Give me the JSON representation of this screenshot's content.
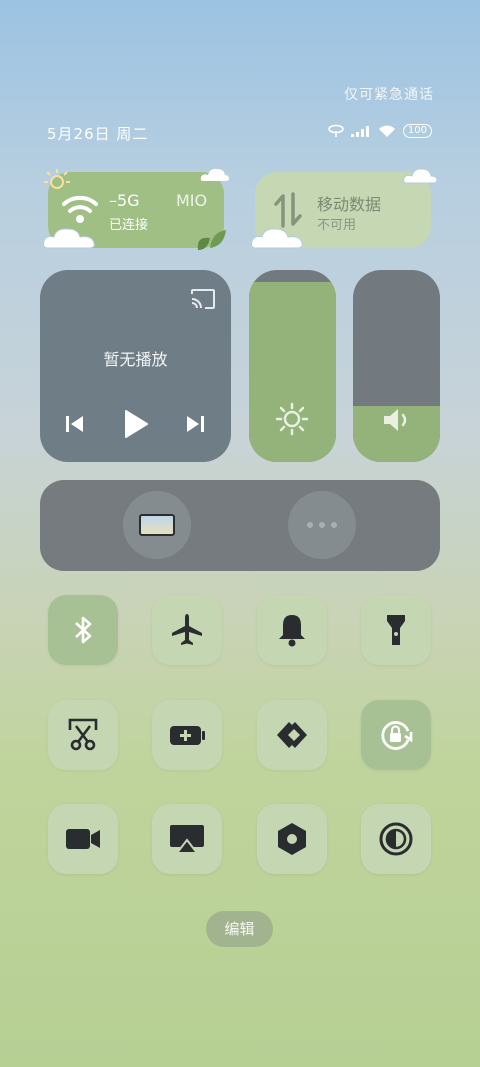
{
  "status": {
    "top_text": "仅可紧急通话",
    "date": "5月26日 周二",
    "battery": "100"
  },
  "wifi_tile": {
    "title": "–5G",
    "title_suffix": "MIO",
    "subtitle": "已连接"
  },
  "mobile_tile": {
    "title": "移动数据",
    "subtitle": "不可用"
  },
  "media": {
    "label": "暂无播放"
  },
  "sliders": {
    "brightness_level": 0.94,
    "volume_level": 0.29
  },
  "quick_buttons": [
    {
      "icon": "bluetooth-icon",
      "active": true
    },
    {
      "icon": "airplane-icon",
      "active": false
    },
    {
      "icon": "bell-icon",
      "active": false
    },
    {
      "icon": "flashlight-icon",
      "active": false
    },
    {
      "icon": "screenshot-icon",
      "active": false
    },
    {
      "icon": "battery-saver-icon",
      "active": false
    },
    {
      "icon": "link-icon",
      "active": false
    },
    {
      "icon": "rotation-lock-icon",
      "active": true
    },
    {
      "icon": "screen-record-icon",
      "active": false
    },
    {
      "icon": "cast-screen-icon",
      "active": false
    },
    {
      "icon": "settings-hex-icon",
      "active": false
    },
    {
      "icon": "contrast-icon",
      "active": false
    }
  ],
  "edit_label": "编辑",
  "colors": {
    "active_green": "#9fbf84",
    "tile_inactive": "#c5d6b3",
    "panel_grey": "#737a7f"
  }
}
